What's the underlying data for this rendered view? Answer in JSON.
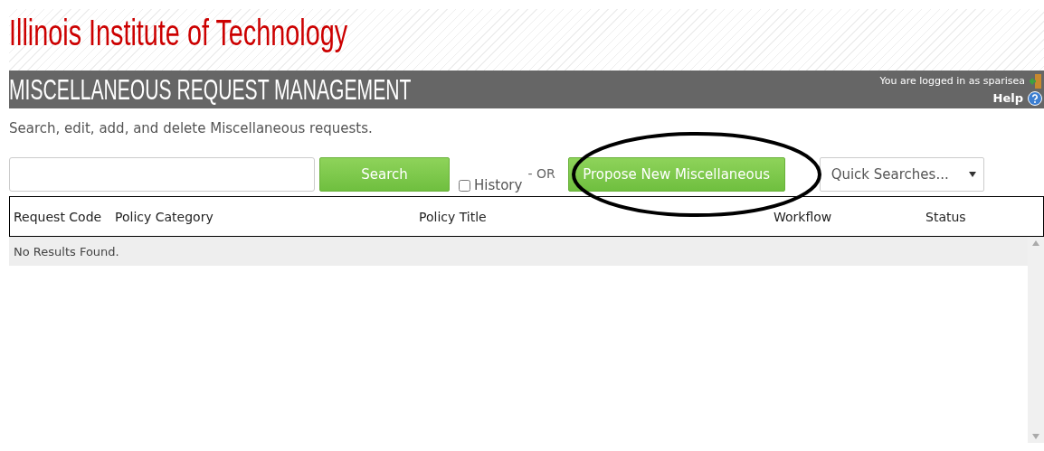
{
  "brand": {
    "title": "Illinois Institute of Technology"
  },
  "page_header": {
    "title": "MISCELLANEOUS REQUEST MANAGEMENT",
    "user_text": "You are logged in as sparisea",
    "help": "Help"
  },
  "description": "Search, edit, add, and delete Miscellaneous requests.",
  "toolbar": {
    "search_button": "Search",
    "history": {
      "label": "History",
      "checked": false
    },
    "or_text": "- OR",
    "propose_button": "Propose New Miscellaneous",
    "quick_searches": "Quick Searches..."
  },
  "table": {
    "columns": [
      "Request Code",
      "Policy Category",
      "Policy Title",
      "Workflow",
      "Status"
    ],
    "empty_text": "No Results Found."
  }
}
